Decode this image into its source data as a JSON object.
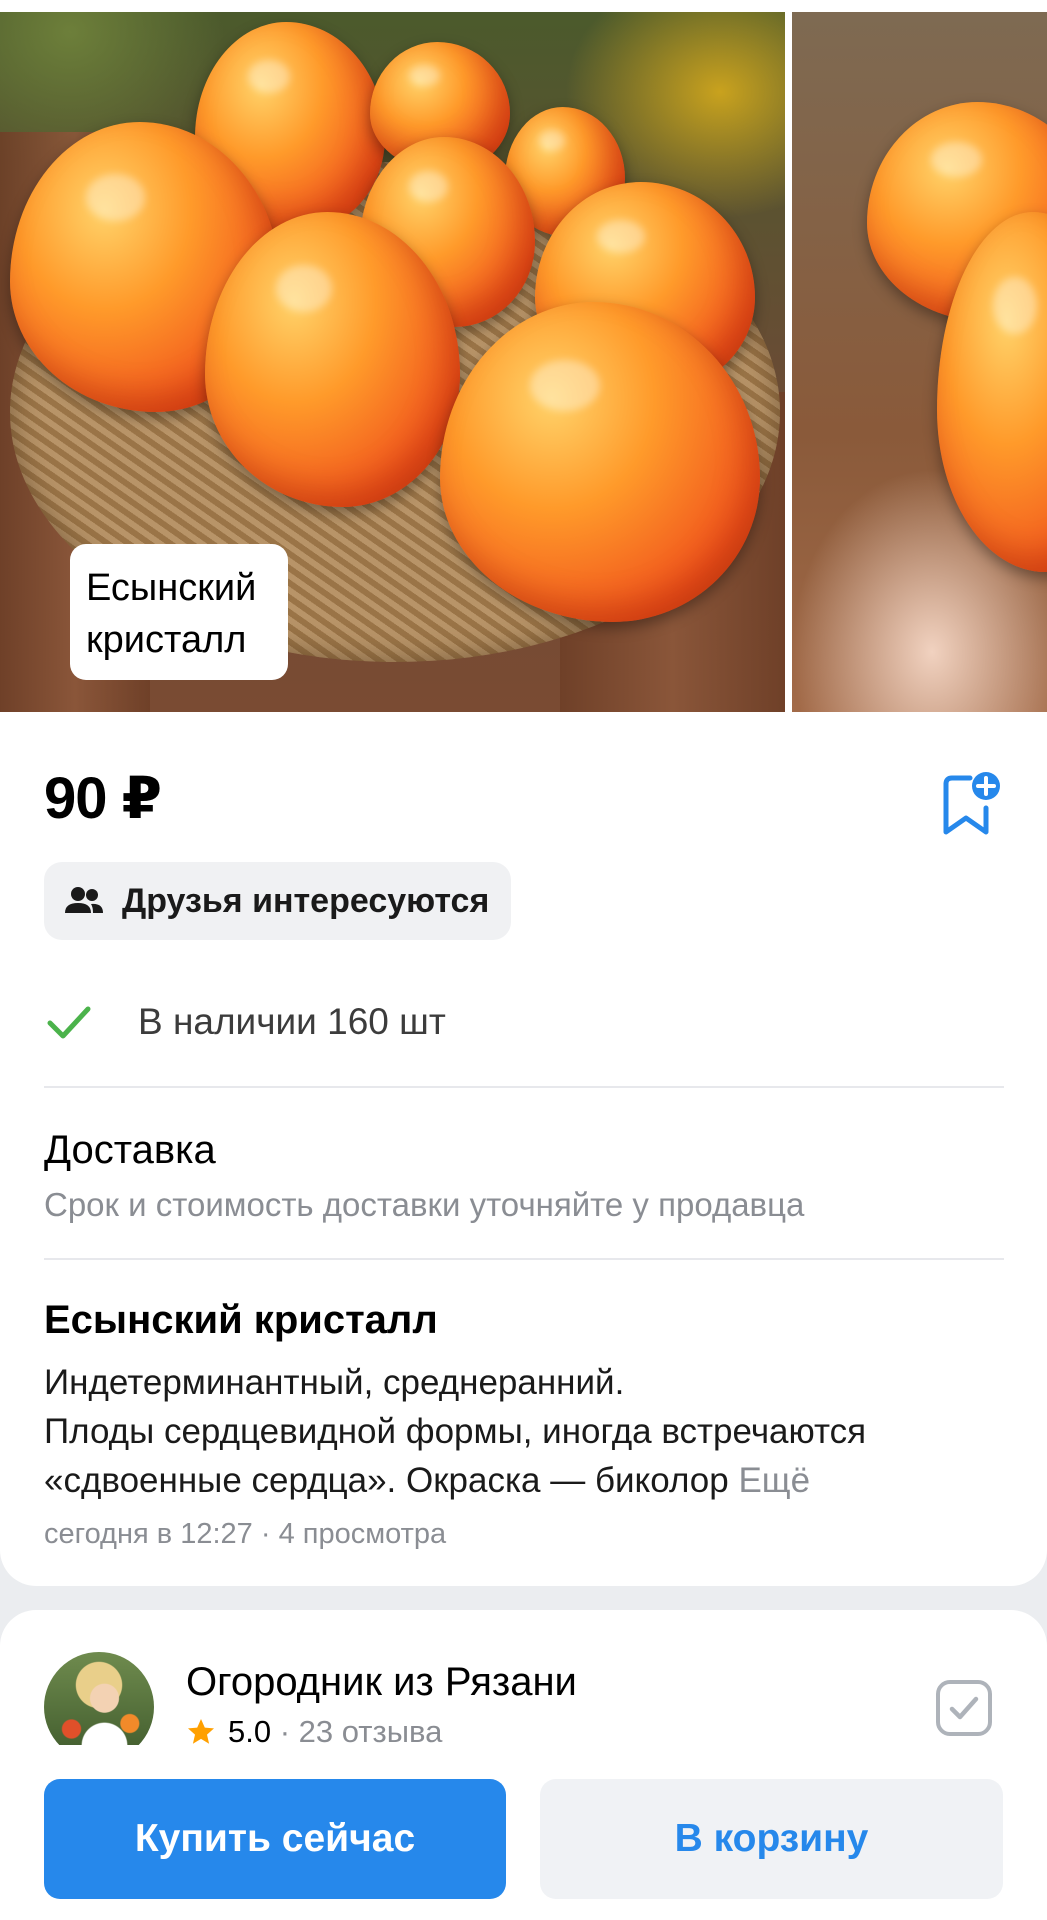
{
  "gallery": {
    "photo_label_line1": "Есынский",
    "photo_label_line2": "кристалл"
  },
  "product": {
    "price": "90 ₽",
    "friends_chip": "Друзья интересуются",
    "stock": "В наличии 160 шт",
    "delivery_title": "Доставка",
    "delivery_subtitle": "Срок и стоимость доставки уточняйте у продавца",
    "title": "Есынский кристалл",
    "description_lines": [
      "Индетерминантный, среднеранний.",
      "Плоды сердцевидной формы, иногда встречаются",
      "«сдвоенные сердца». Окраска — биколор"
    ],
    "more_link": "Ещё",
    "meta": "сегодня в 12:27 · 4 просмотра"
  },
  "seller": {
    "name": "Огородник из Рязани",
    "rating": "5.0",
    "reviews": " · 23 отзыва"
  },
  "actions": {
    "buy_now": "Купить сейчас",
    "add_to_cart": "В корзину"
  },
  "icons": {
    "bookmark": "bookmark-add-icon",
    "friends": "friends-icon",
    "stock": "check-icon",
    "star": "star-icon",
    "verified": "checkbox-checked-icon"
  },
  "colors": {
    "accent": "#2688eb",
    "check_green": "#4bb34b",
    "star": "#ffa000",
    "secondary_text": "#8a8d93"
  }
}
